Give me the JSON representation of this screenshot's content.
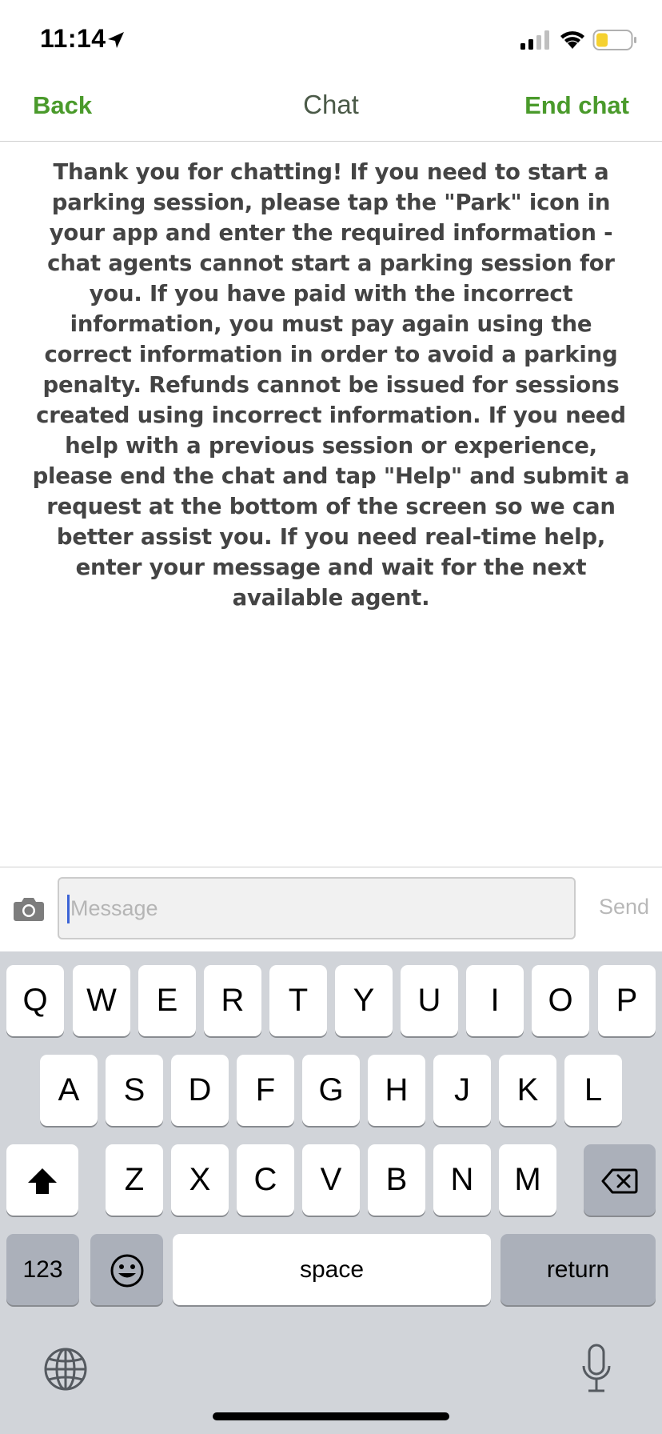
{
  "status_bar": {
    "time": "11:14",
    "icons": [
      "location-arrow-icon",
      "cellular-signal-icon",
      "wifi-icon",
      "battery-icon"
    ],
    "battery_color": "#f5d130"
  },
  "nav": {
    "back_label": "Back",
    "title": "Chat",
    "end_label": "End chat",
    "accent_color": "#4a9a2b"
  },
  "welcome_message": "Thank you for chatting! If you need to start a parking session, please tap the \"Park\" icon in your app and enter the required information - chat agents cannot start a parking session for you. If you have paid with the incorrect information, you must pay again using the correct information in order to avoid a parking penalty. Refunds cannot be issued for sessions created using incorrect information. If you need help with a previous session or experience, please end the chat and tap \"Help\" and submit a request at the bottom of the screen so we can better assist you. If you need real-time help, enter your message and wait for the next available agent.",
  "composer": {
    "placeholder": "Message",
    "value": "",
    "send_label": "Send",
    "camera_icon": "camera-icon"
  },
  "keyboard": {
    "row1": [
      "Q",
      "W",
      "E",
      "R",
      "T",
      "Y",
      "U",
      "I",
      "O",
      "P"
    ],
    "row2": [
      "A",
      "S",
      "D",
      "F",
      "G",
      "H",
      "J",
      "K",
      "L"
    ],
    "row3": [
      "Z",
      "X",
      "C",
      "V",
      "B",
      "N",
      "M"
    ],
    "numbers_label": "123",
    "space_label": "space",
    "return_label": "return",
    "icons": [
      "shift-icon",
      "backspace-icon",
      "emoji-icon",
      "globe-icon",
      "microphone-icon"
    ]
  }
}
